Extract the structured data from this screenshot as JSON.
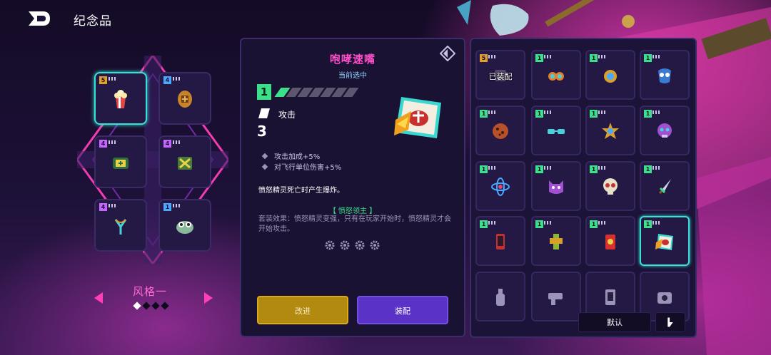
{
  "header": {
    "title": "纪念品",
    "back_icon": "back-arrow-icon"
  },
  "colors": {
    "accent_pink": "#ff3fb8",
    "accent_cyan": "#38e0d6",
    "level_green": "#3de08a",
    "upgrade_gold": "#b38a10",
    "equip_purple": "#5a32c8"
  },
  "memento_slots": [
    {
      "badge": "5",
      "icon": "popcorn-icon",
      "selected": true
    },
    {
      "badge": "4",
      "icon": "shield-medal-icon"
    },
    {
      "badge": "4",
      "icon": "medkit-icon"
    },
    {
      "badge": "4",
      "icon": "crossed-box-icon"
    },
    {
      "badge": "4",
      "icon": "slingshot-icon"
    },
    {
      "badge": "1",
      "icon": "frog-face-icon"
    }
  ],
  "style_selector": {
    "label": "风格一",
    "pages": 4,
    "active_page": 1
  },
  "detail": {
    "name": "咆哮速嘴",
    "status": "当前选中",
    "level": "1",
    "level_max": 7,
    "type_icon": "ticket-icon",
    "type": "攻击",
    "cost": "3",
    "stats": [
      "攻击加成+5%",
      "对飞行单位伤害+5%"
    ],
    "description": "愤怒精灵死亡时产生爆炸。",
    "set_title": "【 愤怒领主 】",
    "set_description": "套装效果：愤怒精灵变强，只有在玩家开始时，愤怒精灵才会开始攻击。",
    "set_pieces": 4,
    "icon": "roaring-mouth-icon"
  },
  "buttons": {
    "upgrade": "改进",
    "equip": "装配",
    "default": "默认",
    "sort_icon": "sort-icon"
  },
  "inventory": [
    {
      "badge": "5",
      "icon": "dark-item-icon",
      "tag": "已装配"
    },
    {
      "badge": "1",
      "icon": "twin-drops-icon"
    },
    {
      "badge": "1",
      "icon": "gold-medal-icon"
    },
    {
      "badge": "1",
      "icon": "blue-mask-icon"
    },
    {
      "badge": "1",
      "icon": "cookie-icon"
    },
    {
      "badge": "1",
      "icon": "sunglasses-icon"
    },
    {
      "badge": "1",
      "icon": "star-badge-icon"
    },
    {
      "badge": "1",
      "icon": "purple-skull-icon"
    },
    {
      "badge": "1",
      "icon": "atom-icon"
    },
    {
      "badge": "1",
      "icon": "cat-face-icon"
    },
    {
      "badge": "1",
      "icon": "skull-icon"
    },
    {
      "badge": "1",
      "icon": "dagger-icon"
    },
    {
      "badge": "1",
      "icon": "phone-icon"
    },
    {
      "badge": "1",
      "icon": "green-tower-icon"
    },
    {
      "badge": "1",
      "icon": "red-can-icon"
    },
    {
      "badge": "1",
      "icon": "roaring-mouth-icon",
      "selected": true
    },
    {
      "badge": "",
      "icon": "bottle-icon"
    },
    {
      "badge": "",
      "icon": "gun-icon"
    },
    {
      "badge": "",
      "icon": "card-icon"
    },
    {
      "badge": "",
      "icon": "gear-box-icon"
    }
  ]
}
